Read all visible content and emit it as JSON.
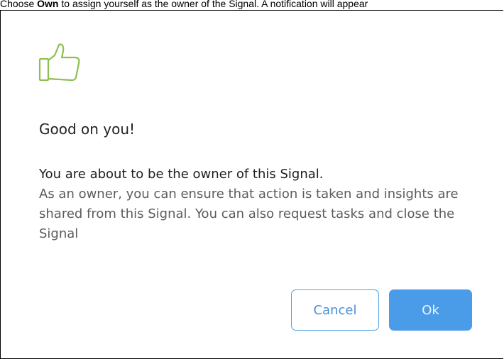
{
  "instruction": {
    "prefix": "Choose ",
    "bold": "Own",
    "suffix": " to assign yourself as the owner of the Signal. A notification will appear"
  },
  "dialog": {
    "icon": "thumbs-up-icon",
    "icon_color": "#8cc04f",
    "title": "Good on you!",
    "lead": "You are about to be the owner of this Signal.",
    "description": "As an owner, you can ensure that action is taken and insights are shared from this Signal. You can also request tasks and close the Signal",
    "buttons": {
      "cancel_label": "Cancel",
      "ok_label": "Ok"
    }
  }
}
